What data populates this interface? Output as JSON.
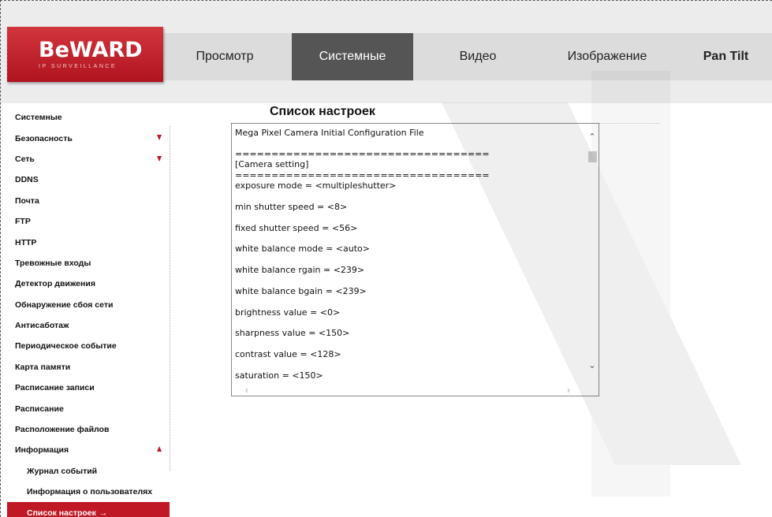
{
  "header": {
    "logo_text": "BeWARD",
    "logo_sub": "IP SURVEILLANCE",
    "tabs": [
      {
        "label": "Просмотр"
      },
      {
        "label": "Системные"
      },
      {
        "label": "Видео"
      },
      {
        "label": "Изображение"
      },
      {
        "label": "Pan Tilt"
      }
    ],
    "active_tab": "Системные"
  },
  "sidebar": {
    "items": [
      {
        "label": "Системные"
      },
      {
        "label": "Безопасность",
        "arrow": "down"
      },
      {
        "label": "Сеть",
        "arrow": "down"
      },
      {
        "label": "DDNS"
      },
      {
        "label": "Почта"
      },
      {
        "label": "FTP"
      },
      {
        "label": "HTTP"
      },
      {
        "label": "Тревожные входы"
      },
      {
        "label": "Детектор движения"
      },
      {
        "label": "Обнаружение сбоя сети"
      },
      {
        "label": "Антисаботаж"
      },
      {
        "label": "Периодическое событие"
      },
      {
        "label": "Карта памяти"
      },
      {
        "label": "Расписание записи"
      },
      {
        "label": "Расписание"
      },
      {
        "label": "Расположение файлов"
      },
      {
        "label": "Информация",
        "arrow": "up"
      },
      {
        "label": "Журнал событий",
        "sub": true
      },
      {
        "label": "Информация о пользователях",
        "sub": true
      },
      {
        "label": "Список настроек",
        "sub": true,
        "active": true,
        "cursor": "→"
      }
    ]
  },
  "main": {
    "title": "Список настроек",
    "config_lines": [
      "Mega Pixel Camera Initial Configuration File",
      "===================================",
      "[Camera setting]",
      "===================================",
      "exposure mode = <multipleshutter>",
      "min shutter speed = <8>",
      "fixed shutter speed = <56>",
      "white balance mode = <auto>",
      "white balance rgain = <239>",
      "white balance bgain = <239>",
      "brightness value = <0>",
      "sharpness value = <150>",
      "contrast value = <128>",
      "saturation = <150>"
    ]
  },
  "colors": {
    "brand_red": "#c01824",
    "active_tab_bg": "#555555",
    "tabbar_bg": "#dcdcdc"
  }
}
